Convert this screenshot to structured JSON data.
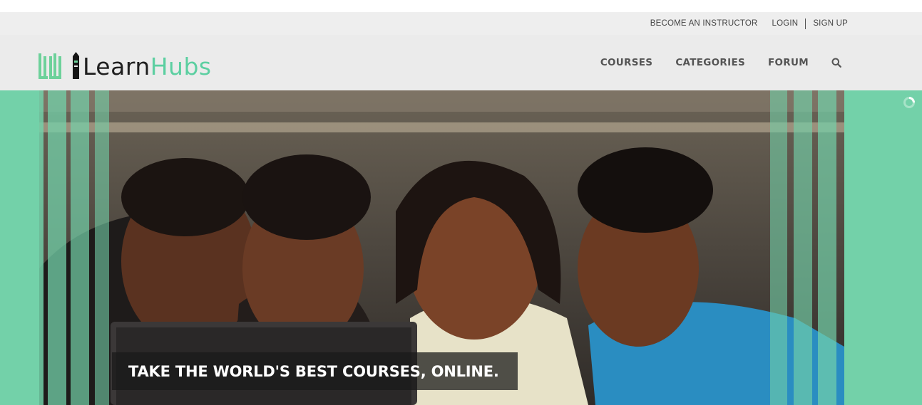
{
  "topbar": {
    "become_instructor": "BECOME AN INSTRUCTOR",
    "login": "LOGIN",
    "signup": "SIGN UP"
  },
  "logo": {
    "text_part1": "Learn",
    "text_part2": "Hubs",
    "icon": "books-pencil-logo"
  },
  "nav": {
    "items": [
      "COURSES",
      "CATEGORIES",
      "FORUM"
    ],
    "search_icon": "search-icon"
  },
  "hero": {
    "image": "students-laughing-at-laptop-photo",
    "tagline": "TAKE THE WORLD'S BEST COURSES, ONLINE.",
    "loader_icon": "loading-spinner-icon"
  },
  "colors": {
    "brand_green": "#5ccfa1",
    "hero_bg": "#73d1a9",
    "topbar_bg": "#eeeeee",
    "header_bg": "#ebebeb",
    "nav_text": "#555555",
    "tagline_bg": "#191919"
  }
}
